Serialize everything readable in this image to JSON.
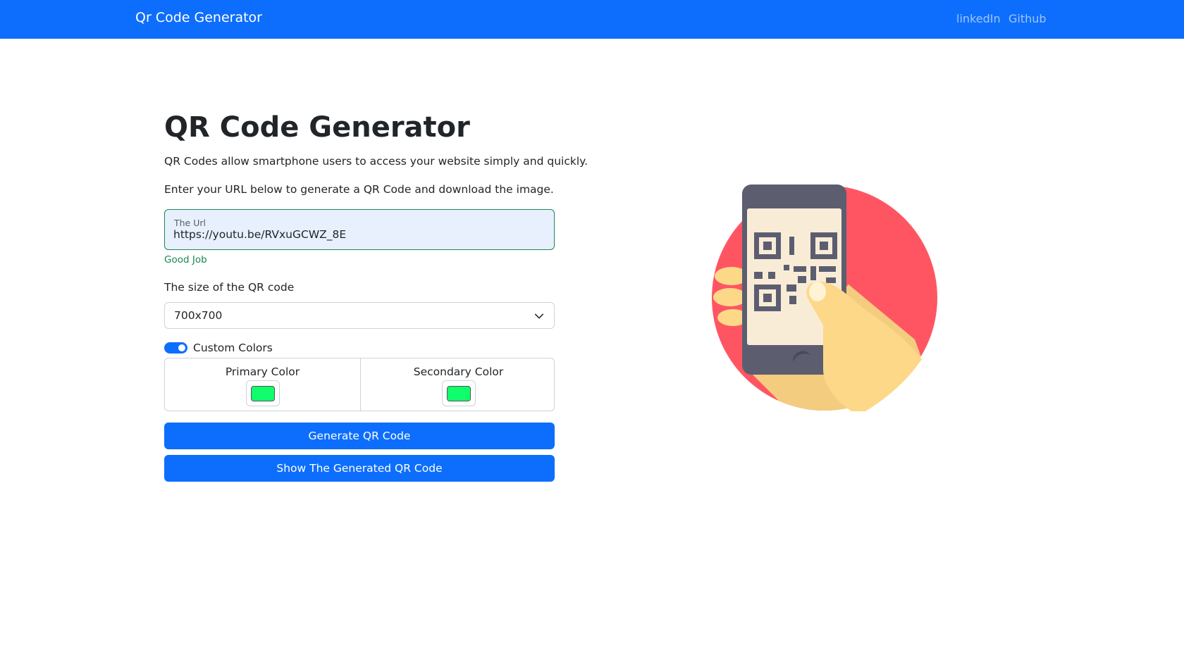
{
  "navbar": {
    "brand": "Qr Code Generator",
    "links": [
      "linkedIn",
      "Github"
    ],
    "color": "#0d6efd"
  },
  "main": {
    "title": "QR Code Generator",
    "description_1": "QR Codes allow smartphone users to access your website simply and quickly.",
    "description_2": "Enter your URL below to generate a QR Code and download the image."
  },
  "url_field": {
    "label": "The Url",
    "value": "https://youtu.be/RVxuGCWZ_8E",
    "feedback": "Good Job",
    "feedback_color": "#198754"
  },
  "size_select": {
    "label": "The size of the QR code",
    "selected": "700x700"
  },
  "custom_colors": {
    "label": "Custom Colors",
    "enabled": true,
    "primary_label": "Primary Color",
    "primary_value": "#11fe6c",
    "secondary_label": "Secondary Color",
    "secondary_value": "#11fe6c"
  },
  "buttons": {
    "generate": "Generate QR Code",
    "show": "Show The Generated QR Code"
  },
  "illustration": {
    "icon": "phone-qr-scan-illustration",
    "colors": {
      "circle": "#ff5563",
      "phone": "#5c5e70",
      "screen": "#f9ecd7",
      "hand": "#fcd888"
    }
  }
}
